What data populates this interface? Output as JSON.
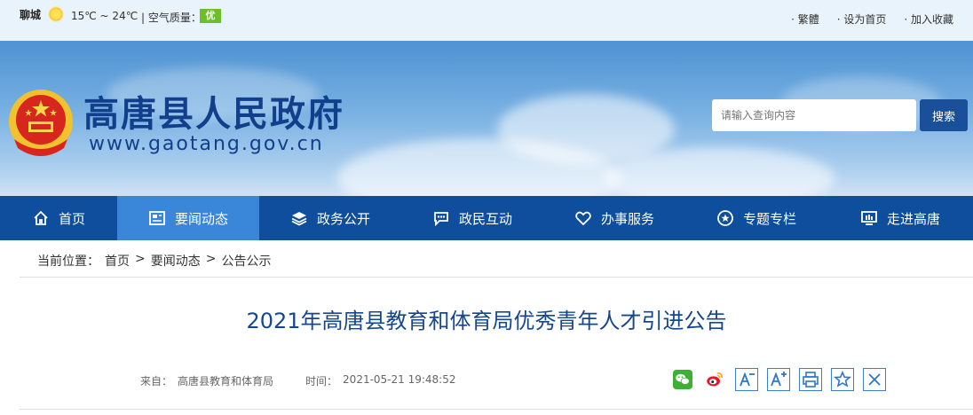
{
  "topbar": {
    "city": "聊城",
    "weather_icon": "sun-icon",
    "temperature": "15℃ ~ 24℃",
    "aq_label": "| 空气质量：",
    "aq_value": "优",
    "aq_color": "#6cbf2a",
    "links": [
      "· 繁體",
      "· 设为首页",
      "· 加入收藏"
    ]
  },
  "header": {
    "title": "高唐县人民政府",
    "url": "www.gaotang.gov.cn",
    "search_placeholder": "请输入查询内容",
    "search_button": "搜索"
  },
  "nav": {
    "items": [
      {
        "label": "首页",
        "icon": "home-icon"
      },
      {
        "label": "要闻动态",
        "icon": "news-icon",
        "active": true
      },
      {
        "label": "政务公开",
        "icon": "layers-icon"
      },
      {
        "label": "政民互动",
        "icon": "chat-icon"
      },
      {
        "label": "办事服务",
        "icon": "heart-icon"
      },
      {
        "label": "专题专栏",
        "icon": "star-badge-icon"
      },
      {
        "label": "走进高唐",
        "icon": "monitor-icon"
      }
    ],
    "bg_color": "#0e4e9c",
    "active_color": "#3a86d9"
  },
  "breadcrumb": {
    "label": "当前位置：",
    "items": [
      "首页",
      "要闻动态",
      "公告公示"
    ],
    "separator": ">"
  },
  "article": {
    "title": "2021年高唐县教育和体育局优秀青年人才引进公告",
    "source_label": "来自：",
    "source": "高唐县教育和体育局",
    "time_label": "时间：",
    "time": "2021-05-21 19:48:52"
  },
  "tools": [
    "wechat-icon",
    "weibo-icon",
    "font-decrease-icon",
    "font-increase-icon",
    "print-icon",
    "favorite-icon",
    "close-icon"
  ]
}
